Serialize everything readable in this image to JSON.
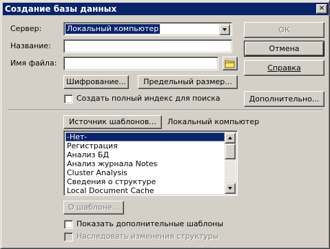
{
  "window": {
    "title": "Создание базы данных",
    "close_glyph": "✕"
  },
  "form": {
    "server_label": "Сервер:",
    "server_value": "Локальный компьютер",
    "title_label": "Название:",
    "title_value": "",
    "filename_label": "Имя файла:",
    "filename_value": ""
  },
  "buttons": {
    "ok": "ОК",
    "cancel": "Отмена",
    "help": "Справка",
    "encryption": "Шифрование...",
    "size_limit": "Предельный размер...",
    "advanced": "Дополнительно...",
    "template_server": "Источник шаблонов...",
    "about_template": "О шаблоне..."
  },
  "checkboxes": {
    "full_text_index": "Создать полный индекс для поиска",
    "show_advanced_templates": "Показать дополнительные шаблоны",
    "inherit_design": "Наследовать изменения структуры"
  },
  "template_source": "Локальный компьютер",
  "templates": [
    "-Нет-",
    "Регистрация",
    "Анализ БД",
    "Анализ журнала Notes",
    "Cluster Analysis",
    "Сведения о структуре",
    "Local Document Cache"
  ],
  "icons": {
    "folder": "folder-icon",
    "close": "close-icon",
    "dropdown": "chevron-down-icon"
  },
  "colors": {
    "face": "#d4d0c8",
    "title_bar": "#0a246a",
    "selection": "#0a246a",
    "folder_yellow": "#ffe666"
  }
}
